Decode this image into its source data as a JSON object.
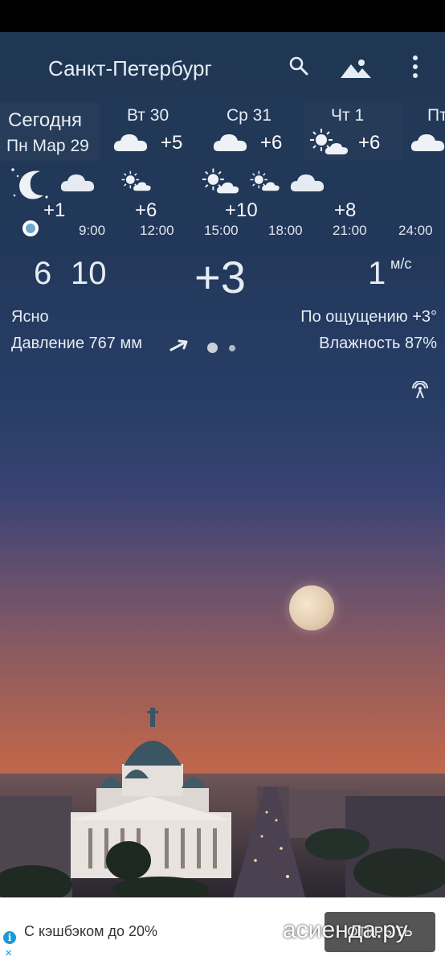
{
  "appbar": {
    "city": "Санкт-Петербург",
    "search_icon": "search-icon",
    "background_icon": "mountain-icon",
    "menu_icon": "more-vert-icon"
  },
  "days": [
    {
      "l1": "Сегодня",
      "l2": "Пн Мар 29"
    },
    {
      "name": "Вт 30",
      "temp": "+5",
      "icon": "cloud-icon"
    },
    {
      "name": "Ср 31",
      "temp": "+6",
      "icon": "cloud-icon"
    },
    {
      "name": "Чт 1",
      "temp": "+6",
      "icon": "sun-cloud-icon"
    },
    {
      "name": "Пт",
      "icon": "cloud-icon"
    }
  ],
  "hourly": {
    "temps": [
      "+1",
      "+6",
      "+10",
      "+8"
    ],
    "times": [
      "9:00",
      "12:00",
      "15:00",
      "18:00",
      "21:00",
      "24:00"
    ],
    "icons": [
      "moon-stars-icon",
      "cloud-icon",
      "sun-cloud-icon",
      "sun-cloud-icon",
      "sun-cloud-icon",
      "cloud-icon"
    ]
  },
  "current": {
    "sunrise_hour": "6",
    "sunrise_min": "10",
    "temp": "+3",
    "wind_value": "1",
    "wind_unit": "м/с",
    "condition": "Ясно",
    "feels_like": "По ощущению +3°",
    "pressure": "Давление 767 мм",
    "humidity": "Влажность 87%"
  },
  "ad": {
    "text": "С кэшбэком до 20%",
    "button": "ОТКРЫТЬ",
    "info_icon": "i",
    "close_icon": "×"
  },
  "watermark": "асиенда.ру",
  "colors": {
    "accent_dot": "#6fa6d0",
    "ad_button": "#555555"
  }
}
